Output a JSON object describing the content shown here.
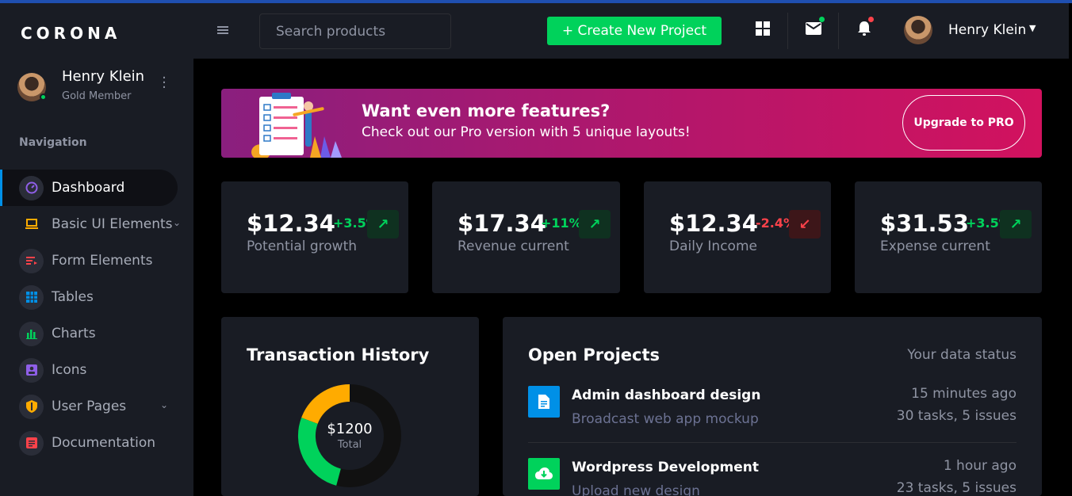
{
  "brand": "CORONA",
  "profile": {
    "name": "Henry Klein",
    "role": "Gold Member"
  },
  "nav_label": "Navigation",
  "nav": [
    {
      "label": "Dashboard",
      "icon": "speedometer-icon",
      "color": "#8f5fe8"
    },
    {
      "label": "Basic UI Elements",
      "icon": "laptop-icon",
      "color": "#ffab00"
    },
    {
      "label": "Form Elements",
      "icon": "list-icon",
      "color": "#fc424a"
    },
    {
      "label": "Tables",
      "icon": "table-icon",
      "color": "#0090e7"
    },
    {
      "label": "Charts",
      "icon": "chart-icon",
      "color": "#00d25b"
    },
    {
      "label": "Icons",
      "icon": "contacts-icon",
      "color": "#8f5fe8"
    },
    {
      "label": "User Pages",
      "icon": "shield-icon",
      "color": "#ffab00"
    },
    {
      "label": "Documentation",
      "icon": "document-icon",
      "color": "#fc424a"
    }
  ],
  "topbar": {
    "search_placeholder": "Search products",
    "create_label": "+ Create New Project",
    "user_name": "Henry Klein"
  },
  "banner": {
    "title": "Want even more features?",
    "subtitle": "Check out our Pro version with 5 unique layouts!",
    "button": "Upgrade to PRO"
  },
  "stats": [
    {
      "value": "$12.34",
      "change": "+3.5%",
      "label": "Potential growth",
      "trend": "up"
    },
    {
      "value": "$17.34",
      "change": "+11%",
      "label": "Revenue current",
      "trend": "up"
    },
    {
      "value": "$12.34",
      "change": "-2.4%",
      "label": "Daily Income",
      "trend": "down"
    },
    {
      "value": "$31.53",
      "change": "+3.5%",
      "label": "Expense current",
      "trend": "up"
    }
  ],
  "transactions": {
    "title": "Transaction History",
    "amount": "$1200",
    "total_label": "Total"
  },
  "projects": {
    "title": "Open Projects",
    "status_label": "Your data status",
    "items": [
      {
        "title": "Admin dashboard design",
        "subtitle": "Broadcast web app mockup",
        "time": "15 minutes ago",
        "tasks": "30 tasks, 5 issues",
        "icon": "file-icon",
        "color": "#0090e7"
      },
      {
        "title": "Wordpress Development",
        "subtitle": "Upload new design",
        "time": "1 hour ago",
        "tasks": "23 tasks, 5 issues",
        "icon": "cloud-download-icon",
        "color": "#00d25b"
      }
    ]
  },
  "colors": {
    "accent_green": "#00d25b",
    "accent_red": "#fc424a",
    "accent_blue": "#0090e7",
    "accent_yellow": "#ffab00",
    "sidebar_bg": "#191c24"
  }
}
